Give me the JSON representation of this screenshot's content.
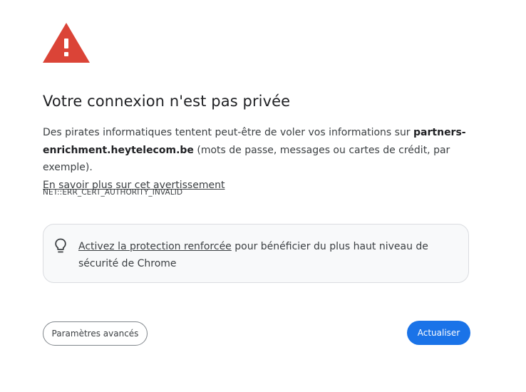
{
  "icons": {
    "warning": "warning-triangle-icon",
    "bulb": "lightbulb-icon"
  },
  "colors": {
    "warning_red": "#db4437",
    "primary_blue": "#1a73e8",
    "promo_bg": "#f8f9fa"
  },
  "heading": "Votre connexion n'est pas privée",
  "message": {
    "before_host": "Des pirates informatiques tentent peut-être de voler vos informations sur ",
    "host": "partners-enrichment.heytelecom.be",
    "after_host": " (mots de passe, messages ou cartes de crédit, par exemple).",
    "learn_more": "En savoir plus sur cet avertissement"
  },
  "error_code": "NET::ERR_CERT_AUTHORITY_INVALID",
  "promo": {
    "link": "Activez la protection renforcée",
    "text": " pour bénéficier du plus haut niveau de sécurité de Chrome"
  },
  "buttons": {
    "advanced": "Paramètres avancés",
    "reload": "Actualiser"
  }
}
